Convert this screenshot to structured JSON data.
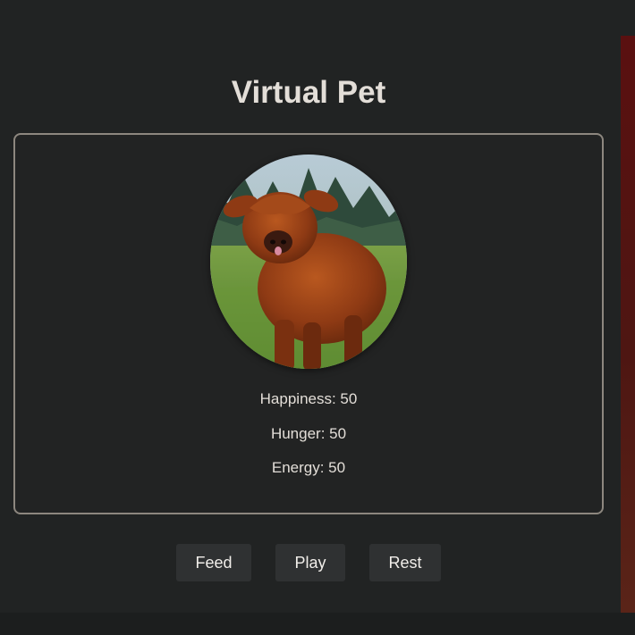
{
  "app": {
    "title": "Virtual Pet"
  },
  "pet": {
    "image_subject": "highland-calf-photo",
    "stats": {
      "happiness": "Happiness: 50",
      "hunger": "Hunger: 50",
      "energy": "Energy: 50"
    }
  },
  "actions": {
    "feed_label": "Feed",
    "play_label": "Play",
    "rest_label": "Rest"
  },
  "colors": {
    "background": "#212323",
    "card_border": "#8d877f",
    "button_bg": "#2f3132",
    "text": "#e3ded8",
    "accent_strip": "#5a1010"
  }
}
